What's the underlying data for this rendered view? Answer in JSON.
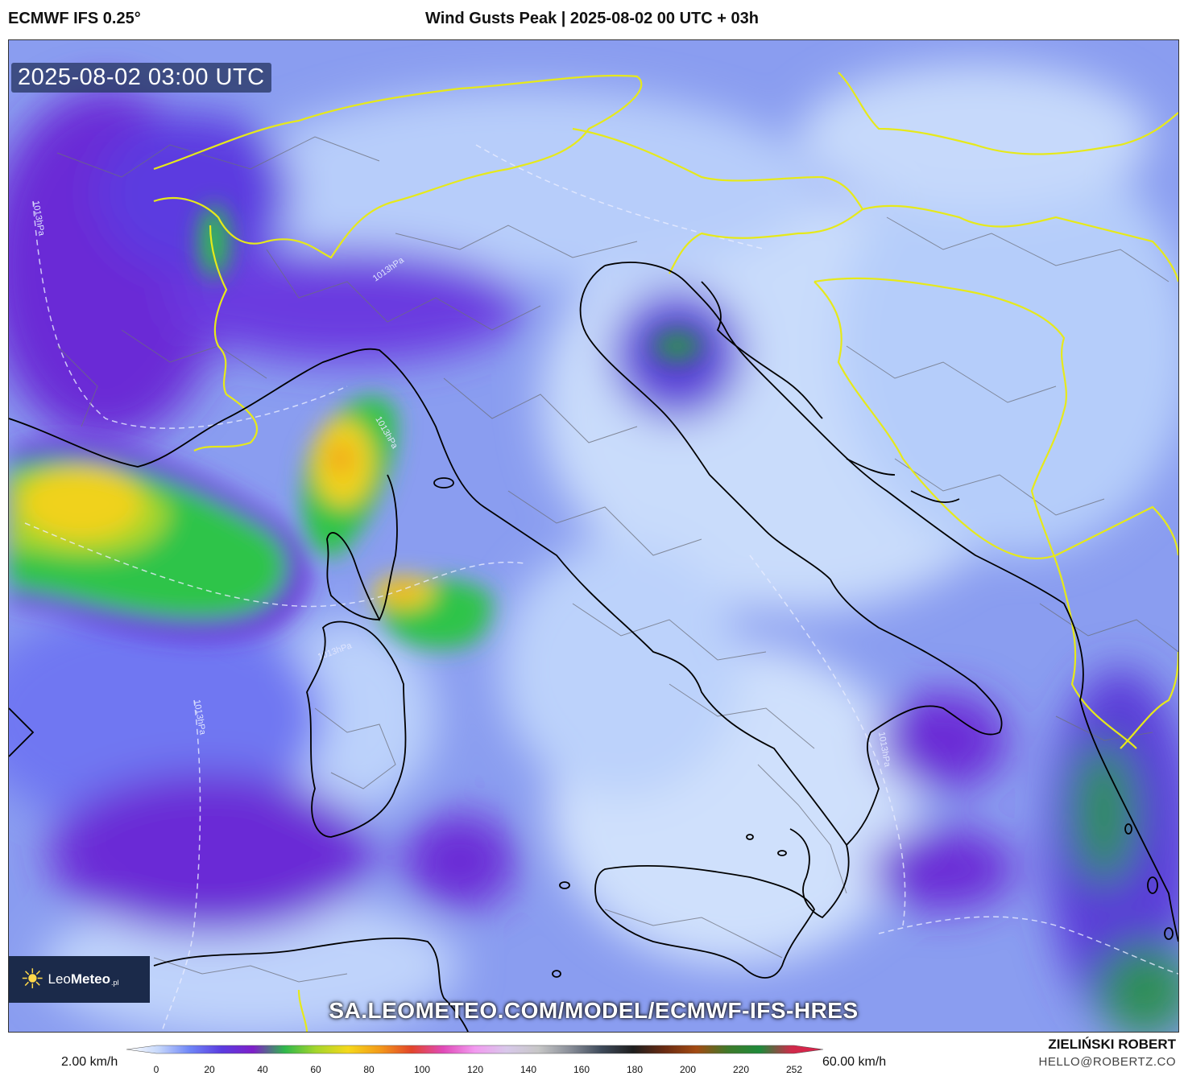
{
  "header": {
    "model": "ECMWF IFS 0.25°",
    "title": "Wind Gusts Peak | 2025-08-02 00 UTC + 03h"
  },
  "map": {
    "valid_time": "2025-08-02 03:00 UTC",
    "url": "SA.LEOMETEO.COM/MODEL/ECMWF-IFS-HRES",
    "isobar_label": "1013hPa",
    "logo": {
      "brand_light": "Leo",
      "brand_bold": "Meteo",
      "tld": ".pl"
    },
    "colors": {
      "sea_low": "#c5dafb",
      "mid": "#6f76f2",
      "violet": "#6a2cd6",
      "green": "#2ec44a",
      "yellow": "#f0d21a",
      "orange": "#f39a1a",
      "coast": "#000000",
      "border": "#e6e91a"
    }
  },
  "legend": {
    "unit_min": "2.00 km/h",
    "unit_max": "60.00 km/h",
    "ticks": [
      "0",
      "20",
      "40",
      "60",
      "80",
      "100",
      "120",
      "140",
      "160",
      "180",
      "200",
      "220",
      "252"
    ],
    "colorbar": [
      "#ffffff",
      "#c7d8fb",
      "#6f86f7",
      "#5b3ce0",
      "#7e1fc9",
      "#2fb84c",
      "#a6d62b",
      "#f5d81b",
      "#f39a1a",
      "#e2452a",
      "#e04ab8",
      "#f29af0",
      "#d8c8ea",
      "#c7c7c7",
      "#8a8f99",
      "#3e4a5a",
      "#1e1e1e",
      "#6a2b12",
      "#a34a12",
      "#3e7a2a",
      "#1e8a3a",
      "#cf2a4a",
      "#e01f4a"
    ]
  },
  "credit": {
    "author": "ZIELIŃSKI ROBERT",
    "email": "HELLO@ROBERTZ.CO"
  }
}
